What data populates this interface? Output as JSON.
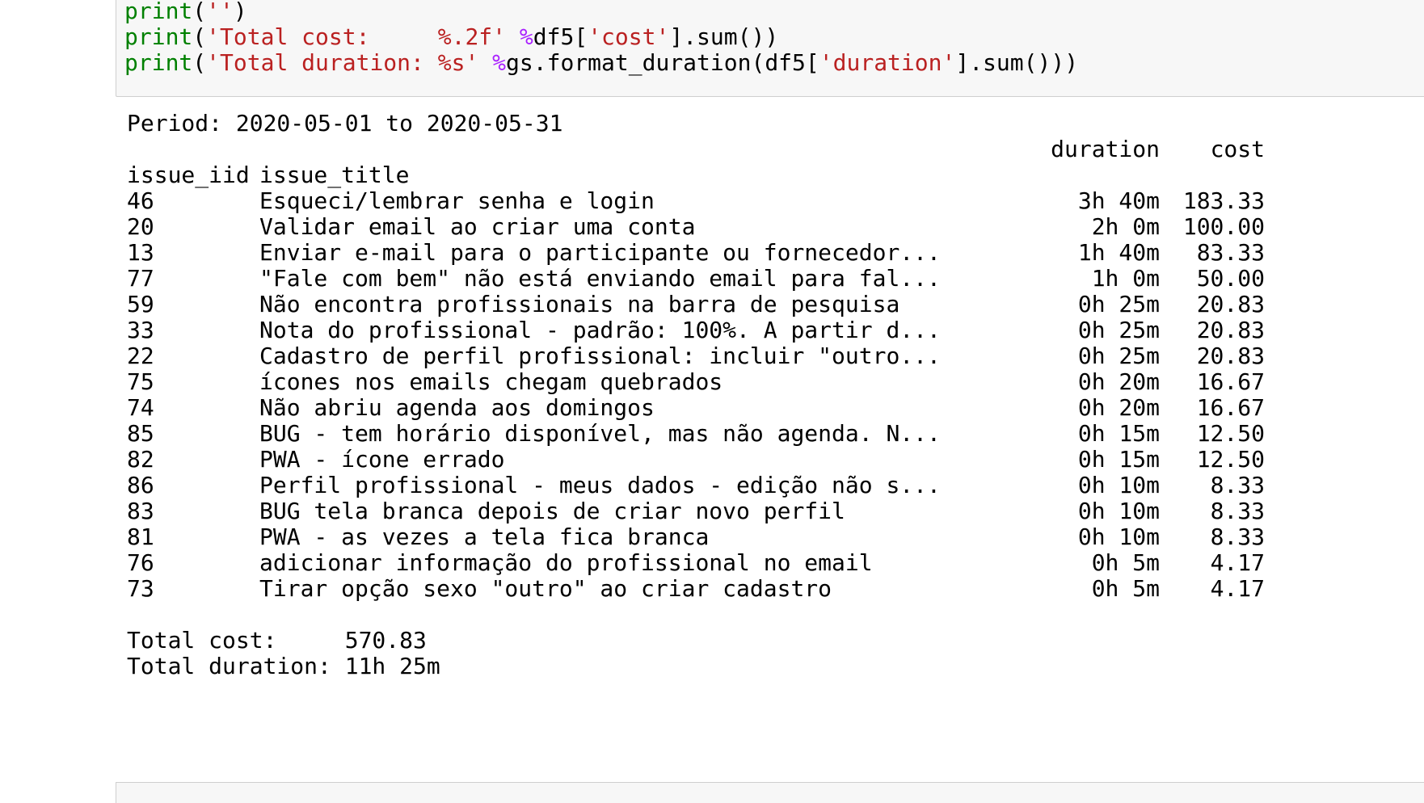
{
  "code": {
    "lines": [
      [
        {
          "t": "print",
          "c": "kw"
        },
        {
          "t": "(",
          "c": "plain"
        },
        {
          "t": "''",
          "c": "str"
        },
        {
          "t": ")",
          "c": "plain"
        }
      ],
      [
        {
          "t": "print",
          "c": "kw"
        },
        {
          "t": "(",
          "c": "plain"
        },
        {
          "t": "'Total cost:     %.2f'",
          "c": "str"
        },
        {
          "t": " ",
          "c": "plain"
        },
        {
          "t": "%",
          "c": "op"
        },
        {
          "t": "df5[",
          "c": "plain"
        },
        {
          "t": "'cost'",
          "c": "str"
        },
        {
          "t": "].sum())",
          "c": "plain"
        }
      ],
      [
        {
          "t": "print",
          "c": "kw"
        },
        {
          "t": "(",
          "c": "plain"
        },
        {
          "t": "'Total duration: %s'",
          "c": "str"
        },
        {
          "t": " ",
          "c": "plain"
        },
        {
          "t": "%",
          "c": "op"
        },
        {
          "t": "gs.format_duration(df5[",
          "c": "plain"
        },
        {
          "t": "'duration'",
          "c": "str"
        },
        {
          "t": "].sum()))",
          "c": "plain"
        }
      ]
    ]
  },
  "output": {
    "period": "Period: 2020-05-01 to 2020-05-31",
    "col_duration": "duration",
    "col_cost": "cost",
    "idx_iid": "issue_iid",
    "idx_title": "issue_title",
    "rows": [
      {
        "iid": "46",
        "title": "Esqueci/lembrar senha e login",
        "duration": "3h 40m",
        "cost": "183.33"
      },
      {
        "iid": "20",
        "title": "Validar email ao criar uma conta",
        "duration": "2h 0m",
        "cost": "100.00"
      },
      {
        "iid": "13",
        "title": "Enviar e-mail para o participante ou fornecedor...",
        "duration": "1h 40m",
        "cost": "83.33"
      },
      {
        "iid": "77",
        "title": "\"Fale com bem\" não está enviando email para fal...",
        "duration": "1h 0m",
        "cost": "50.00"
      },
      {
        "iid": "59",
        "title": "Não encontra profissionais na barra de pesquisa",
        "duration": "0h 25m",
        "cost": "20.83"
      },
      {
        "iid": "33",
        "title": "Nota do profissional - padrão: 100%. A partir d...",
        "duration": "0h 25m",
        "cost": "20.83"
      },
      {
        "iid": "22",
        "title": "Cadastro de perfil profissional: incluir \"outro...",
        "duration": "0h 25m",
        "cost": "20.83"
      },
      {
        "iid": "75",
        "title": "ícones nos emails chegam quebrados",
        "duration": "0h 20m",
        "cost": "16.67"
      },
      {
        "iid": "74",
        "title": "Não abriu agenda aos domingos",
        "duration": "0h 20m",
        "cost": "16.67"
      },
      {
        "iid": "85",
        "title": "BUG - tem horário disponível, mas não agenda. N...",
        "duration": "0h 15m",
        "cost": "12.50"
      },
      {
        "iid": "82",
        "title": "PWA - ícone errado",
        "duration": "0h 15m",
        "cost": "12.50"
      },
      {
        "iid": "86",
        "title": "Perfil profissional - meus dados - edição não s...",
        "duration": "0h 10m",
        "cost": "8.33"
      },
      {
        "iid": "83",
        "title": "BUG tela branca depois de criar novo perfil",
        "duration": "0h 10m",
        "cost": "8.33"
      },
      {
        "iid": "81",
        "title": "PWA - as vezes a tela fica branca",
        "duration": "0h 10m",
        "cost": "8.33"
      },
      {
        "iid": "76",
        "title": "adicionar informação do profissional no email",
        "duration": "0h 5m",
        "cost": "4.17"
      },
      {
        "iid": "73",
        "title": "Tirar opção sexo \"outro\" ao criar cadastro",
        "duration": "0h 5m",
        "cost": "4.17"
      }
    ],
    "total_cost": "Total cost:     570.83",
    "total_duration": "Total duration: 11h 25m"
  },
  "colors": {
    "keyword": "#008000",
    "string": "#ba2121",
    "operator": "#aa22ff",
    "cell_background": "#f7f7f7"
  }
}
